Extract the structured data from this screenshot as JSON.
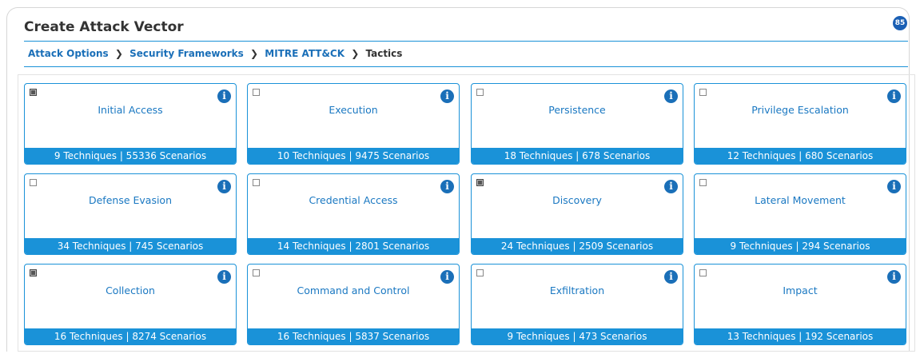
{
  "header": {
    "title": "Create Attack Vector",
    "badge": "85"
  },
  "breadcrumb": {
    "items": [
      "Attack Options",
      "Security Frameworks",
      "MITRE ATT&CK"
    ],
    "current": "Tactics",
    "separator": "❯"
  },
  "colors": {
    "accent": "#1a92d8",
    "link": "#1a6fb8"
  },
  "tactics": [
    {
      "name": "Initial Access",
      "summary": "9 Techniques | 55336 Scenarios",
      "checked": true
    },
    {
      "name": "Execution",
      "summary": "10 Techniques | 9475 Scenarios",
      "checked": false
    },
    {
      "name": "Persistence",
      "summary": "18 Techniques | 678 Scenarios",
      "checked": false
    },
    {
      "name": "Privilege Escalation",
      "summary": "12 Techniques | 680 Scenarios",
      "checked": false
    },
    {
      "name": "Defense Evasion",
      "summary": "34 Techniques | 745 Scenarios",
      "checked": false
    },
    {
      "name": "Credential Access",
      "summary": "14 Techniques | 2801 Scenarios",
      "checked": false
    },
    {
      "name": "Discovery",
      "summary": "24 Techniques | 2509 Scenarios",
      "checked": true
    },
    {
      "name": "Lateral Movement",
      "summary": "9 Techniques | 294 Scenarios",
      "checked": false
    },
    {
      "name": "Collection",
      "summary": "16 Techniques | 8274 Scenarios",
      "checked": true
    },
    {
      "name": "Command and Control",
      "summary": "16 Techniques | 5837 Scenarios",
      "checked": false
    },
    {
      "name": "Exfiltration",
      "summary": "9 Techniques | 473 Scenarios",
      "checked": false
    },
    {
      "name": "Impact",
      "summary": "13 Techniques | 192 Scenarios",
      "checked": false
    }
  ]
}
